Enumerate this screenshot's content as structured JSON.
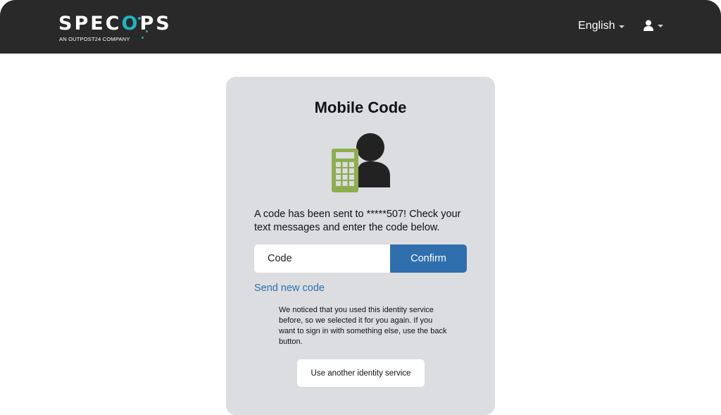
{
  "header": {
    "logo": {
      "wordmark": "SPECOPS",
      "tagline": "AN OUTPOST24 COMPANY",
      "accent_color": "#1fb3c3"
    },
    "language": {
      "selected": "English"
    },
    "user_menu": {
      "icon": "user-icon"
    },
    "background": "#292929"
  },
  "card": {
    "title": "Mobile Code",
    "illustration": {
      "icon": "mobile-phone-user-icon",
      "phone_color": "#8ead4d",
      "person_color": "#222222"
    },
    "message": "A code has been sent to *****507! Check your text messages and enter the code below.",
    "code_input": {
      "placeholder": "Code",
      "value": ""
    },
    "confirm_label": "Confirm",
    "send_new_code_label": "Send new code",
    "notice": "We noticed that you used this identity service before, so we selected it for you again. If you want to sign in with something else, use the back button.",
    "alt_service_label": "Use another identity service",
    "background": "#dcdde1",
    "accent": "#2f6fad"
  }
}
